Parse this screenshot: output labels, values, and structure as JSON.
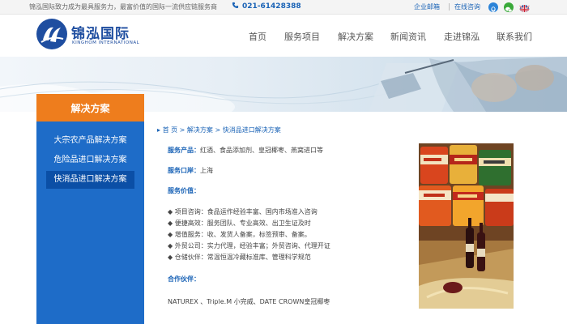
{
  "topbar": {
    "slogan": "锦泓国际致力成为最具服务力，最富价值的国际一流供应链服务商",
    "phone": "021-61428388",
    "mail": "企业邮箱",
    "consult": "在线咨询"
  },
  "header": {
    "logo_cn": "锦泓国际",
    "logo_en": "KINGHOM INTERNATIONAL",
    "nav": [
      "首页",
      "服务项目",
      "解决方案",
      "新闻资讯",
      "走进锦泓",
      "联系我们"
    ]
  },
  "sidebar": {
    "title": "解决方案",
    "items": [
      {
        "label": "大宗农产品解决方案",
        "active": false
      },
      {
        "label": "危险品进口解决方案",
        "active": false
      },
      {
        "label": "快消品进口解决方案",
        "active": true
      }
    ]
  },
  "breadcrumb": {
    "home": "首 页",
    "sep": ">",
    "section": "解决方案",
    "current": "快消品进口解决方案"
  },
  "content": {
    "product_label": "服务产品：",
    "product_value": "红酒、食品添加剂、皇冠椰枣、燕窝进口等",
    "port_label": "服务口岸：",
    "port_value": "上海",
    "value_label": "服务价值：",
    "bullets": [
      "项目咨询：食品运作经验丰富、国内市场准入咨询",
      "便捷高效：服务团队、专业高效、出卫生证及时",
      "增值服务：收、发货人备案，标签预审、备案。",
      "外贸公司：实力代理，经验丰富；外贸咨询、代理开证",
      "仓储伙伴：常温恒温冷藏标准库、管理科学规范"
    ],
    "partner_label": "合作伙伴：",
    "partners": "NATUREX 、Triple.M 小完威、DATE CROWN皇冠椰枣"
  },
  "photo": {
    "can_labels": [
      "Halcón",
      "Halcón",
      "CASCALE",
      "Halcón",
      "CASCALE"
    ]
  },
  "colors": {
    "brand_blue": "#1a63b6",
    "sidebar_blue": "#1e6cc8",
    "sidebar_active": "#0b4fa6",
    "accent_orange": "#ee7d1d"
  },
  "icons": [
    "phone-icon",
    "qq-icon",
    "wechat-icon",
    "uk-flag-icon",
    "bullet-icon"
  ]
}
